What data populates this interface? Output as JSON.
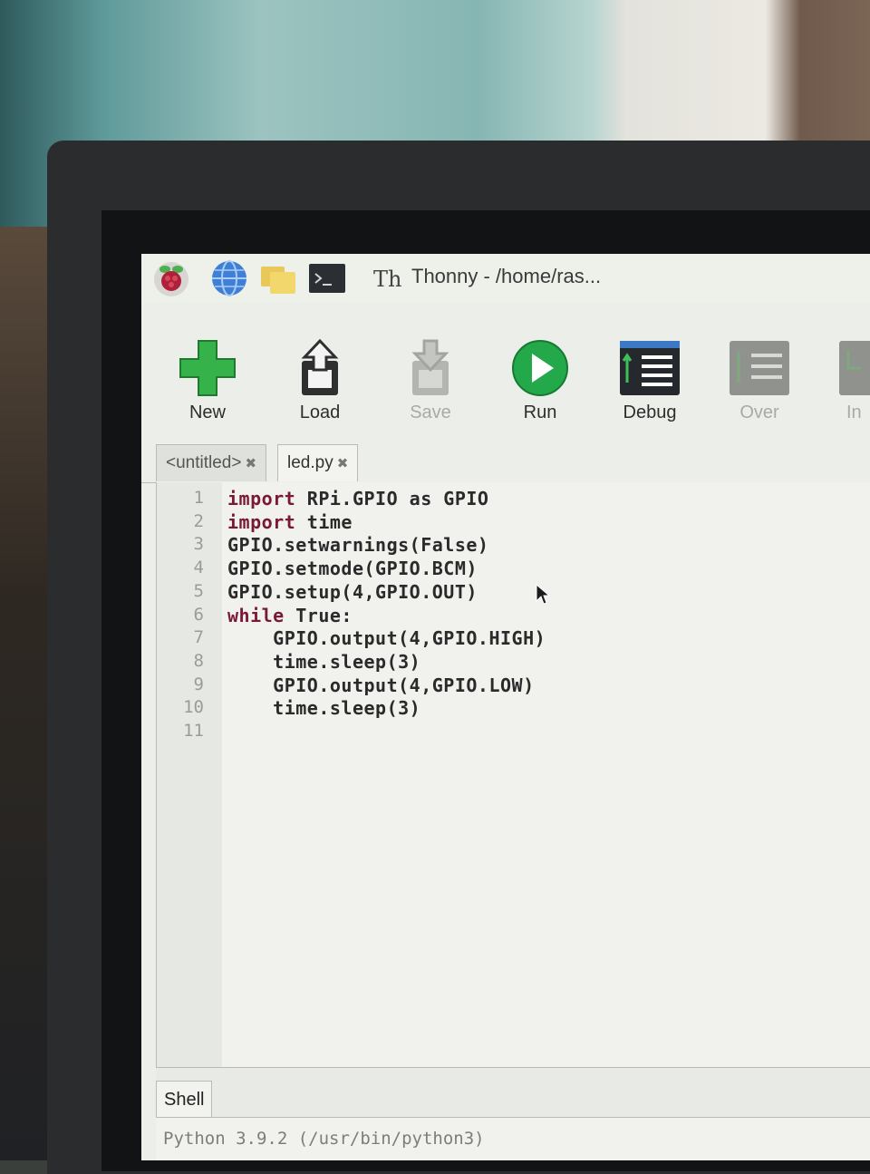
{
  "taskbar": {
    "window_title": "Thonny  -  /home/ras..."
  },
  "toolbar": {
    "buttons": [
      {
        "label": "New",
        "icon": "new-file-icon",
        "color": "#3bb54a"
      },
      {
        "label": "Load",
        "icon": "load-icon"
      },
      {
        "label": "Save",
        "icon": "save-icon",
        "disabled": true
      },
      {
        "label": "Run",
        "icon": "run-icon",
        "color": "#22a84a"
      },
      {
        "label": "Debug",
        "icon": "debug-icon"
      },
      {
        "label": "Over",
        "icon": "step-over-icon",
        "disabled": true
      },
      {
        "label": "In",
        "icon": "step-into-icon",
        "disabled": true
      }
    ]
  },
  "tabs": [
    {
      "label": "<untitled>",
      "active": false
    },
    {
      "label": "led.py",
      "active": true
    }
  ],
  "editor": {
    "lines": [
      {
        "num": "1",
        "kw": "import",
        "rest": " RPi.GPIO as GPIO"
      },
      {
        "num": "2",
        "kw": "import",
        "rest": " time"
      },
      {
        "num": "3",
        "kw": "",
        "rest": "GPIO.setwarnings(False)"
      },
      {
        "num": "4",
        "kw": "",
        "rest": "GPIO.setmode(GPIO.BCM)"
      },
      {
        "num": "5",
        "kw": "",
        "rest": "GPIO.setup(4,GPIO.OUT)"
      },
      {
        "num": "6",
        "kw": "while",
        "rest": " True:"
      },
      {
        "num": "7",
        "kw": "",
        "rest": "    GPIO.output(4,GPIO.HIGH)"
      },
      {
        "num": "8",
        "kw": "",
        "rest": "    time.sleep(3)"
      },
      {
        "num": "9",
        "kw": "",
        "rest": "    GPIO.output(4,GPIO.LOW)"
      },
      {
        "num": "10",
        "kw": "",
        "rest": "    time.sleep(3)"
      },
      {
        "num": "11",
        "kw": "",
        "rest": ""
      }
    ],
    "keyword_color": "#7a1838"
  },
  "shell": {
    "tab_label": "Shell",
    "text": "Python 3.9.2 (/usr/bin/python3)"
  }
}
